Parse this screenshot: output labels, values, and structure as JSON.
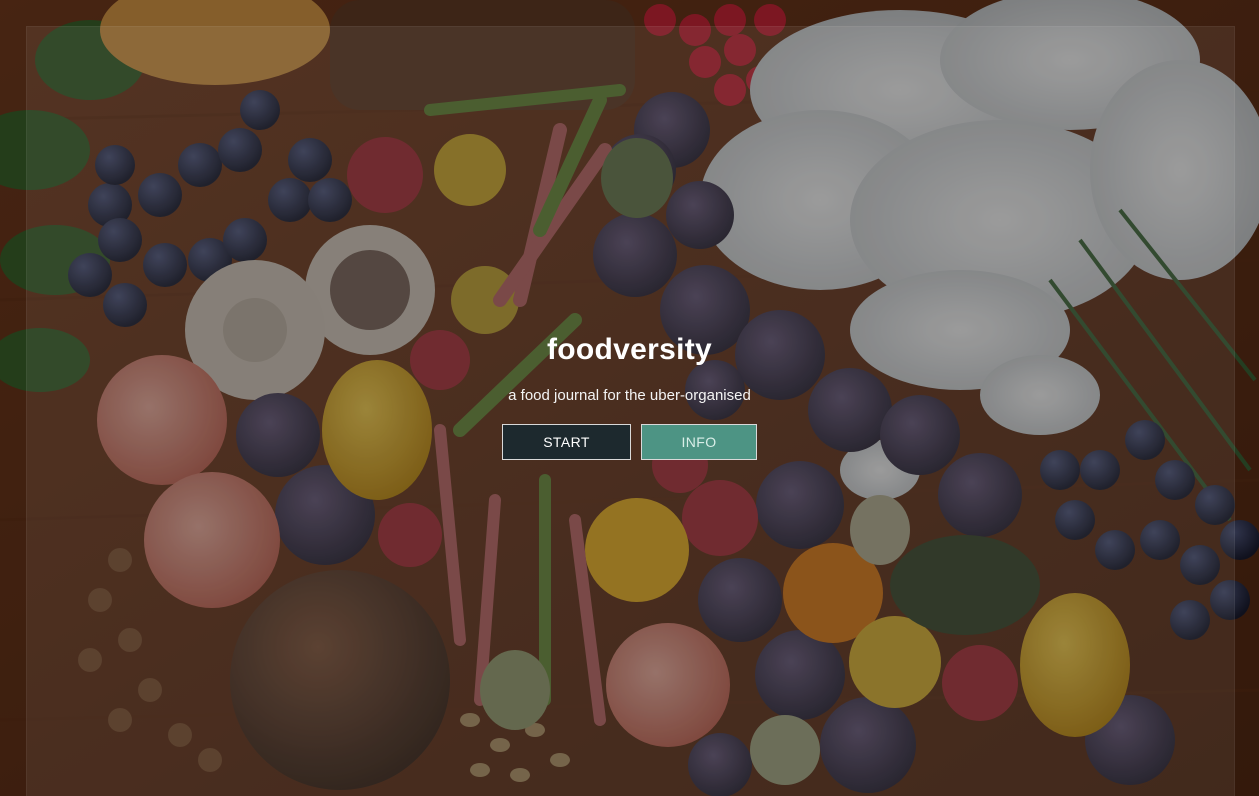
{
  "app": {
    "title": "foodversity",
    "tagline": "a food journal for the uber-organised"
  },
  "actions": {
    "start_label": "START",
    "info_label": "INFO"
  },
  "colors": {
    "start_button_bg": "#1d292e",
    "info_button_bg": "#4d9484",
    "title_text": "#ffffff"
  }
}
